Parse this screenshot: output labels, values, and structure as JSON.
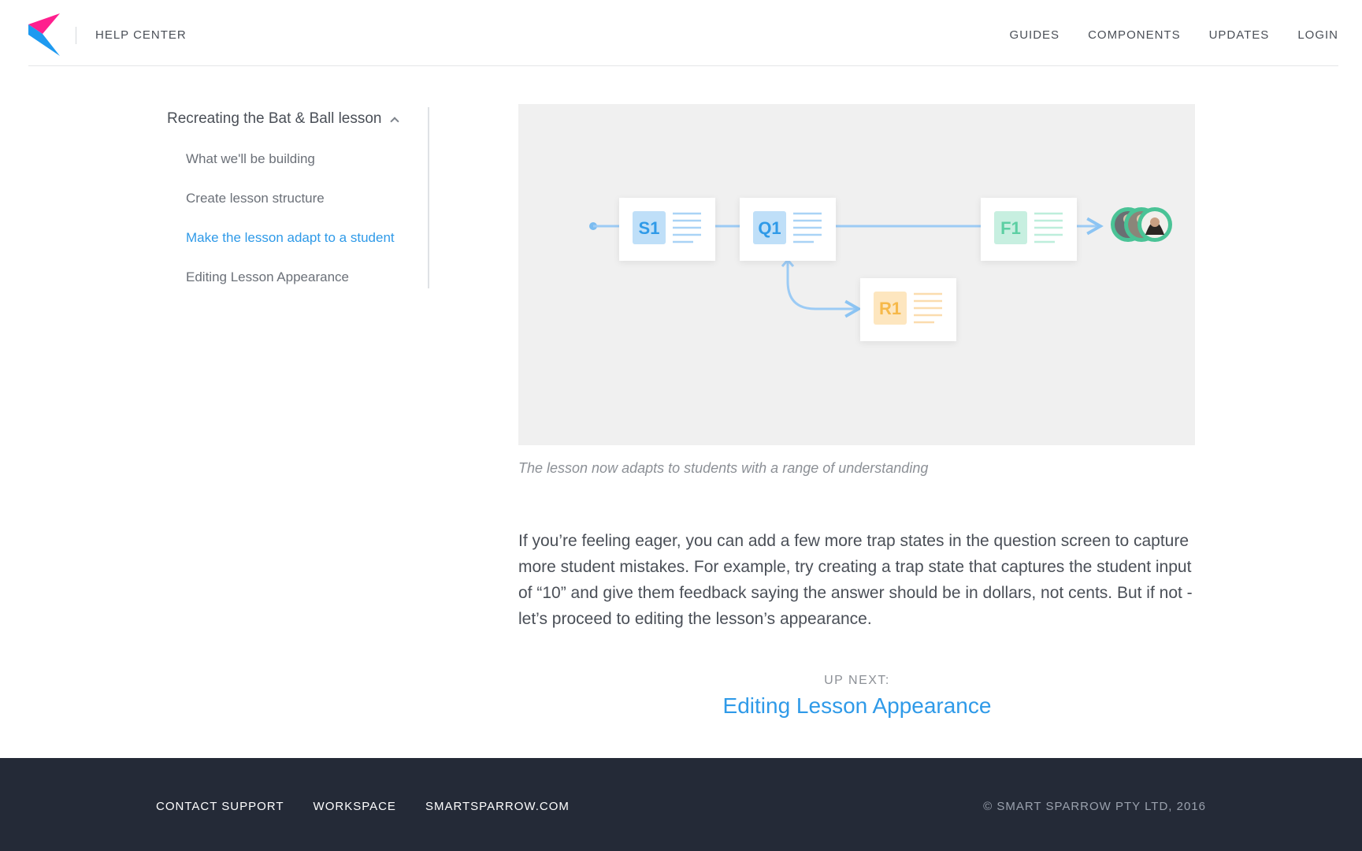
{
  "header": {
    "brand_label": "HELP CENTER",
    "nav": [
      "GUIDES",
      "COMPONENTS",
      "UPDATES",
      "LOGIN"
    ],
    "logo_colors": [
      "#ff1f8e",
      "#1e9af0"
    ]
  },
  "sidebar": {
    "heading": "Recreating the Bat & Ball lesson",
    "items": [
      "What we'll be building",
      "Create lesson structure",
      "Make the lesson adapt to a student",
      "Editing Lesson Appearance"
    ],
    "active_index": 2
  },
  "figure": {
    "nodes": [
      "S1",
      "Q1",
      "F1",
      "R1"
    ],
    "icons": [
      "student-avatars-icon"
    ],
    "caption": "The lesson now adapts to students with a range of understanding"
  },
  "article": {
    "paragraph": "If you’re feeling eager, you can add a few more trap states in the question screen to capture more student mistakes. For example, try creating a trap state that captures the student input of “10” and give them feedback saying the answer should be in dollars, not cents. But if not - let’s proceed to editing the lesson’s appearance."
  },
  "up_next": {
    "label": "UP NEXT:",
    "title": "Editing Lesson Appearance"
  },
  "footer": {
    "links": [
      "CONTACT SUPPORT",
      "WORKSPACE",
      "SMARTSPARROW.COM"
    ],
    "copyright": "© SMART SPARROW PTY LTD, 2016"
  },
  "colors": {
    "accent": "#2f9ae8",
    "footer_bg": "#242a37",
    "s1": "#2f9ae8",
    "q1": "#2f9ae8",
    "f1": "#5ccfa3",
    "r1": "#f6b94a"
  }
}
